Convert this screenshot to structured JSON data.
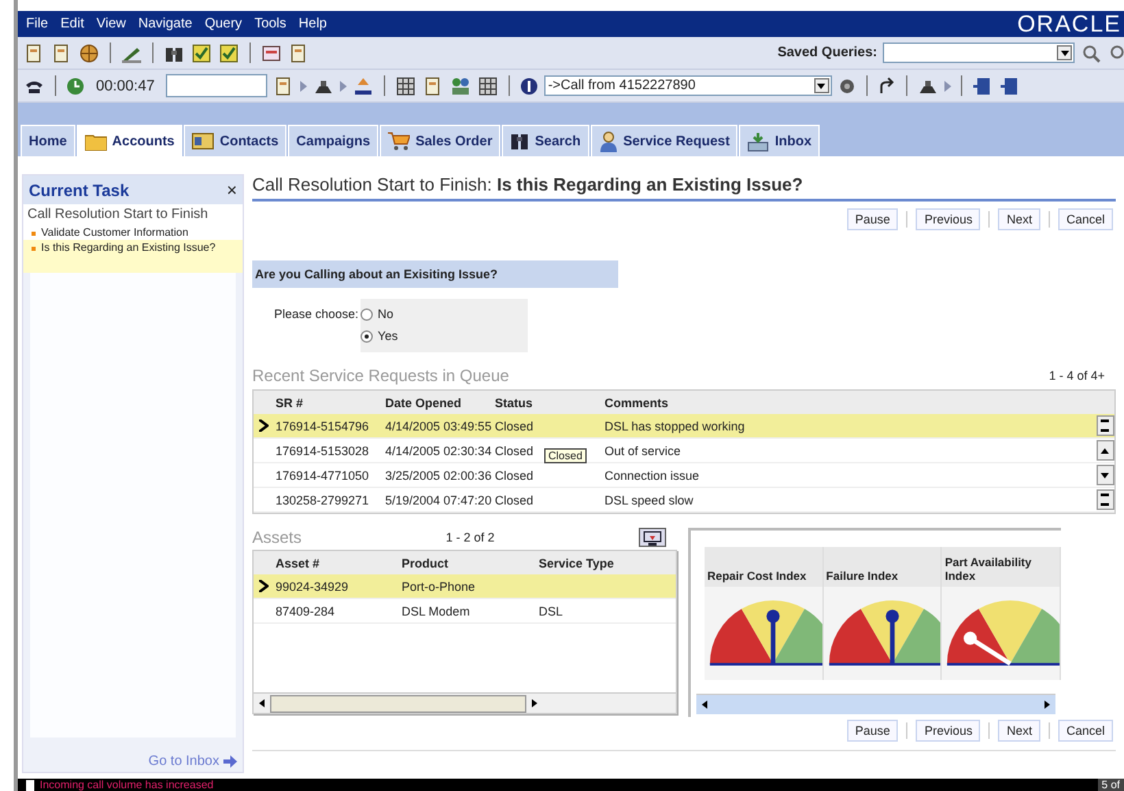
{
  "menu": [
    "File",
    "Edit",
    "View",
    "Navigate",
    "Query",
    "Tools",
    "Help"
  ],
  "logo": "ORACLE",
  "saved_queries": {
    "label": "Saved Queries:"
  },
  "call_bar": {
    "timer": "00:00:47",
    "call_select": "->Call from 4152227890"
  },
  "tabs": [
    {
      "label": "Home",
      "selected": false
    },
    {
      "label": "Accounts",
      "selected": true
    },
    {
      "label": "Contacts",
      "selected": false
    },
    {
      "label": "Campaigns",
      "selected": false
    },
    {
      "label": "Sales Order",
      "selected": false
    },
    {
      "label": "Search",
      "selected": false
    },
    {
      "label": "Service Request",
      "selected": false
    },
    {
      "label": "Inbox",
      "selected": false
    }
  ],
  "current_task": {
    "title": "Current Task",
    "close": "×",
    "process": "Call Resolution Start to Finish",
    "steps": [
      {
        "label": "Validate Customer Information",
        "selected": false
      },
      {
        "label": "Is this Regarding an Existing Issue?",
        "selected": true
      }
    ],
    "link": "Go to Inbox"
  },
  "page_title": "Call Resolution Start to Finish:  **Is this Regarding an Existing Issue?**",
  "nav_buttons_top": [
    "Pause",
    "Previous",
    "Next",
    "Cancel"
  ],
  "question": "Are you Calling about an Exisiting Issue?",
  "choice": {
    "label": "Please choose:",
    "options": [
      {
        "label": "No",
        "selected": false
      },
      {
        "label": "Yes",
        "selected": true
      }
    ]
  },
  "service_requests": {
    "title": "Recent Service Requests in Queue",
    "count": "1 - 4 of 4+",
    "columns": [
      "SR #",
      "Date Opened",
      "Status",
      "Comments"
    ],
    "rows": [
      {
        "cells": [
          "176914-5154796",
          "4/14/2005 03:49:55",
          "Closed",
          "DSL has stopped working"
        ],
        "selected": true
      },
      {
        "cells": [
          "176914-5153028",
          "4/14/2005 02:30:34",
          "Closed",
          "Out of service"
        ],
        "selected": false
      },
      {
        "cells": [
          "176914-4771050",
          "3/25/2005 02:00:36",
          "Closed",
          "Connection issue"
        ],
        "selected": false
      },
      {
        "cells": [
          "130258-2799271",
          "5/19/2004 07:47:20",
          "Closed",
          "DSL speed slow"
        ],
        "selected": false
      }
    ],
    "tooltip": "Closed"
  },
  "assets": {
    "title": "Assets",
    "count": "1 - 2 of 2",
    "columns": [
      "Asset #",
      "Product",
      "Service Type"
    ],
    "rows": [
      {
        "cells": [
          "99024-34929",
          "Port-o-Phone",
          ""
        ],
        "selected": true
      },
      {
        "cells": [
          "87409-284",
          "DSL Modem",
          "DSL"
        ],
        "selected": false
      }
    ]
  },
  "gauges": [
    {
      "label": "Repair Cost Index"
    },
    {
      "label": "Failure Index"
    },
    {
      "label": "Part Availability Index"
    }
  ],
  "nav_buttons_bottom": [
    "Pause",
    "Previous",
    "Next",
    "Cancel"
  ],
  "status_bar": {
    "message": "Incoming call volume has increased",
    "page": "5 of"
  }
}
